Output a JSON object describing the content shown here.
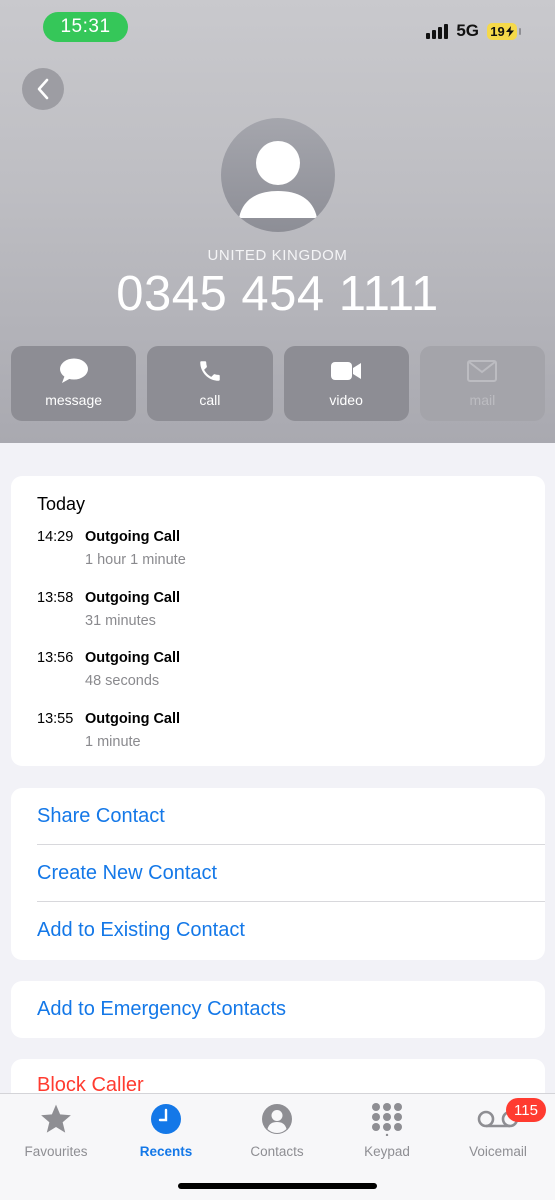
{
  "status_bar": {
    "time": "15:31",
    "network": "5G",
    "battery": "19"
  },
  "header": {
    "back_label": "Back",
    "country": "UNITED KINGDOM",
    "phone_number": "0345 454 1111"
  },
  "actions": [
    {
      "label": "message",
      "icon": "message-bubble-icon",
      "enabled": true
    },
    {
      "label": "call",
      "icon": "phone-icon",
      "enabled": true
    },
    {
      "label": "video",
      "icon": "video-camera-icon",
      "enabled": true
    },
    {
      "label": "mail",
      "icon": "envelope-icon",
      "enabled": false
    }
  ],
  "recents": {
    "day": "Today",
    "calls": [
      {
        "time": "14:29",
        "type": "Outgoing Call",
        "duration": "1 hour 1 minute"
      },
      {
        "time": "13:58",
        "type": "Outgoing Call",
        "duration": "31 minutes"
      },
      {
        "time": "13:56",
        "type": "Outgoing Call",
        "duration": "48 seconds"
      },
      {
        "time": "13:55",
        "type": "Outgoing Call",
        "duration": "1 minute"
      }
    ]
  },
  "contact_actions": {
    "share": "Share Contact",
    "create": "Create New Contact",
    "add_existing": "Add to Existing Contact"
  },
  "emergency": {
    "label": "Add to Emergency Contacts"
  },
  "block": {
    "label": "Block Caller"
  },
  "tabbar": {
    "favourites": "Favourites",
    "recents": "Recents",
    "contacts": "Contacts",
    "keypad": "Keypad",
    "voicemail": "Voicemail",
    "voicemail_badge": "115",
    "active": "recents"
  },
  "colors": {
    "accent": "#1478e8",
    "destructive": "#ff3b30",
    "badge": "#ff3b30",
    "status_pill": "#35c759"
  }
}
